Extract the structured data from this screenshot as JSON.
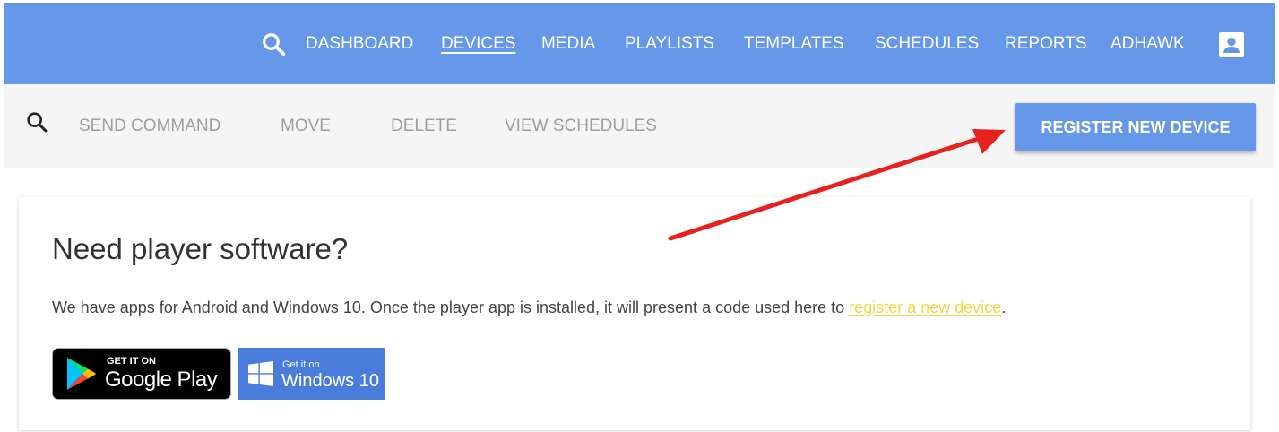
{
  "nav": {
    "items": [
      {
        "label": "DASHBOARD",
        "active": false
      },
      {
        "label": "DEVICES",
        "active": true
      },
      {
        "label": "MEDIA",
        "active": false
      },
      {
        "label": "PLAYLISTS",
        "active": false
      },
      {
        "label": "TEMPLATES",
        "active": false
      },
      {
        "label": "SCHEDULES",
        "active": false
      },
      {
        "label": "REPORTS",
        "active": false
      },
      {
        "label": "ADHAWK",
        "active": false
      }
    ],
    "search_icon": "search-icon",
    "account_icon": "account-box-icon"
  },
  "toolbar": {
    "search_icon": "search-icon",
    "send_command": "SEND COMMAND",
    "move": "MOVE",
    "delete": "DELETE",
    "view_schedules": "VIEW SCHEDULES",
    "register": "REGISTER NEW DEVICE"
  },
  "card": {
    "title": "Need player software?",
    "desc_before": "We have apps for Android and Windows 10. Once the player app is installed, it will present a code used here to ",
    "desc_link": "register a new device",
    "desc_after": ".",
    "google_play": {
      "small": "GET IT ON",
      "big": "Google Play"
    },
    "windows": {
      "small": "Get it on",
      "big": "Windows 10"
    }
  },
  "colors": {
    "primary": "#6598e8",
    "toolbar_bg": "#f5f5f5",
    "link": "#f2d64b",
    "annotation": "#e8201e",
    "windows_badge": "#4a7cdc"
  }
}
